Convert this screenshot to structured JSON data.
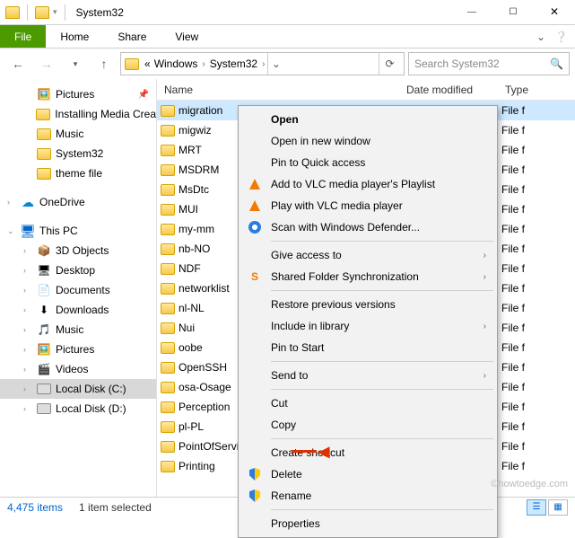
{
  "window": {
    "title": "System32",
    "minimize": "—",
    "maximize": "☐",
    "close": "✕"
  },
  "ribbon": {
    "file": "File",
    "home": "Home",
    "share": "Share",
    "view": "View"
  },
  "nav": {
    "back": "←",
    "forward": "→",
    "up": "↑",
    "crumb_prefix": "«",
    "crumb1": "Windows",
    "crumb2": "System32",
    "chev": "›",
    "drop": "⌄",
    "refresh": "⟳"
  },
  "search": {
    "placeholder": "Search System32",
    "icon": "🔍"
  },
  "sidebar": {
    "pictures": "Pictures",
    "installing": "Installing Media Crea",
    "music": "Music",
    "system32": "System32",
    "theme": "theme file",
    "onedrive": "OneDrive",
    "thispc": "This PC",
    "obj3d": "3D Objects",
    "desktop": "Desktop",
    "documents": "Documents",
    "downloads": "Downloads",
    "music2": "Music",
    "pictures2": "Pictures",
    "videos": "Videos",
    "localc": "Local Disk (C:)",
    "locald": "Local Disk (D:)",
    "pin": "📌"
  },
  "columns": {
    "name": "Name",
    "date": "Date modified",
    "type": "Type"
  },
  "files": {
    "type_folder": "File f",
    "items": [
      "migration",
      "migwiz",
      "MRT",
      "MSDRM",
      "MsDtc",
      "MUI",
      "my-mm",
      "nb-NO",
      "NDF",
      "networklist",
      "nl-NL",
      "Nui",
      "oobe",
      "OpenSSH",
      "osa-Osage",
      "Perception",
      "pl-PL",
      "PointOfService",
      "Printing"
    ]
  },
  "context_menu": {
    "open": "Open",
    "open_new": "Open in new window",
    "pin_quick": "Pin to Quick access",
    "vlc_add": "Add to VLC media player's Playlist",
    "vlc_play": "Play with VLC media player",
    "defender": "Scan with Windows Defender...",
    "give_access": "Give access to",
    "shared_sync": "Shared Folder Synchronization",
    "restore": "Restore previous versions",
    "include_lib": "Include in library",
    "pin_start": "Pin to Start",
    "send_to": "Send to",
    "cut": "Cut",
    "copy": "Copy",
    "shortcut": "Create shortcut",
    "delete": "Delete",
    "rename": "Rename",
    "properties": "Properties"
  },
  "status": {
    "count": "4,475 items",
    "selected": "1 item selected"
  },
  "watermark": "©howtoedge.com"
}
